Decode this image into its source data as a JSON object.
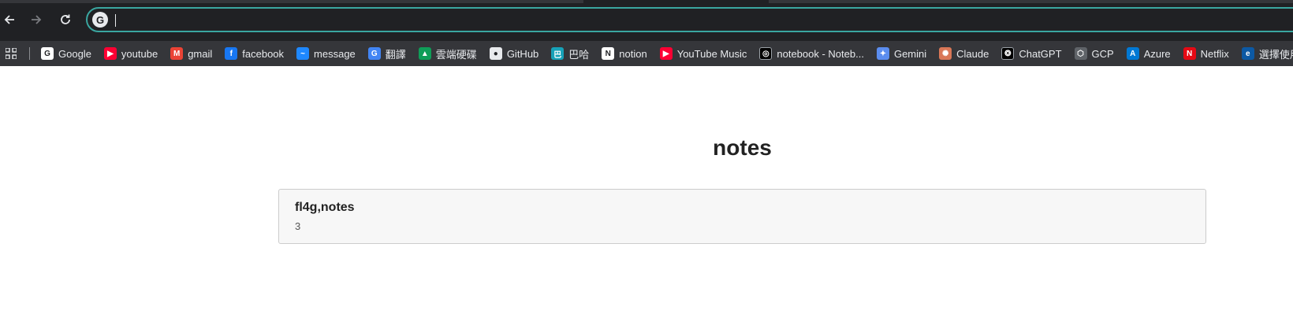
{
  "browser": {
    "nav": {
      "back": "back-icon",
      "forward": "forward-icon",
      "reload": "reload-icon"
    },
    "omnibox": {
      "value": "",
      "icon": "google-g-icon",
      "icon_letter": "G"
    },
    "accent": "#3aa6a0"
  },
  "bookmarks": [
    {
      "label": "Google",
      "icon": "google-icon",
      "color": "#ffffff",
      "glyph": "G"
    },
    {
      "label": "youtube",
      "icon": "youtube-icon",
      "color": "#ff0033",
      "glyph": "▶"
    },
    {
      "label": "gmail",
      "icon": "gmail-icon",
      "color": "#ea4335",
      "glyph": "M"
    },
    {
      "label": "facebook",
      "icon": "facebook-icon",
      "color": "#1877f2",
      "glyph": "f"
    },
    {
      "label": "message",
      "icon": "messenger-icon",
      "color": "#1e88ff",
      "glyph": "~"
    },
    {
      "label": "翻譯",
      "icon": "translate-icon",
      "color": "#4285f4",
      "glyph": "G"
    },
    {
      "label": "雲端硬碟",
      "icon": "drive-icon",
      "color": "#0f9d58",
      "glyph": "▲"
    },
    {
      "label": "GitHub",
      "icon": "github-icon",
      "color": "#e8eaed",
      "glyph": "●"
    },
    {
      "label": "巴哈",
      "icon": "bahamut-icon",
      "color": "#17a2b8",
      "glyph": "巴"
    },
    {
      "label": "notion",
      "icon": "notion-icon",
      "color": "#ffffff",
      "glyph": "N"
    },
    {
      "label": "YouTube Music",
      "icon": "youtube-music-icon",
      "color": "#ff0033",
      "glyph": "▶"
    },
    {
      "label": "notebook - Noteb...",
      "icon": "notebooklm-icon",
      "color": "#000000",
      "glyph": "◎"
    },
    {
      "label": "Gemini",
      "icon": "gemini-icon",
      "color": "#5b8def",
      "glyph": "✦"
    },
    {
      "label": "Claude",
      "icon": "claude-icon",
      "color": "#d97757",
      "glyph": "✺"
    },
    {
      "label": "ChatGPT",
      "icon": "chatgpt-icon",
      "color": "#000000",
      "glyph": "❂"
    },
    {
      "label": "GCP",
      "icon": "gcp-icon",
      "color": "#5f6368",
      "glyph": "⬡"
    },
    {
      "label": "Azure",
      "icon": "azure-icon",
      "color": "#0078d4",
      "glyph": "A"
    },
    {
      "label": "Netflix",
      "icon": "netflix-icon",
      "color": "#e50914",
      "glyph": "N"
    },
    {
      "label": "選擇使用者",
      "icon": "edge-icon",
      "color": "#0c59a4",
      "glyph": "e"
    }
  ],
  "page": {
    "title": "notes",
    "notes": [
      {
        "title": "fl4g,notes",
        "meta": "3"
      }
    ]
  }
}
